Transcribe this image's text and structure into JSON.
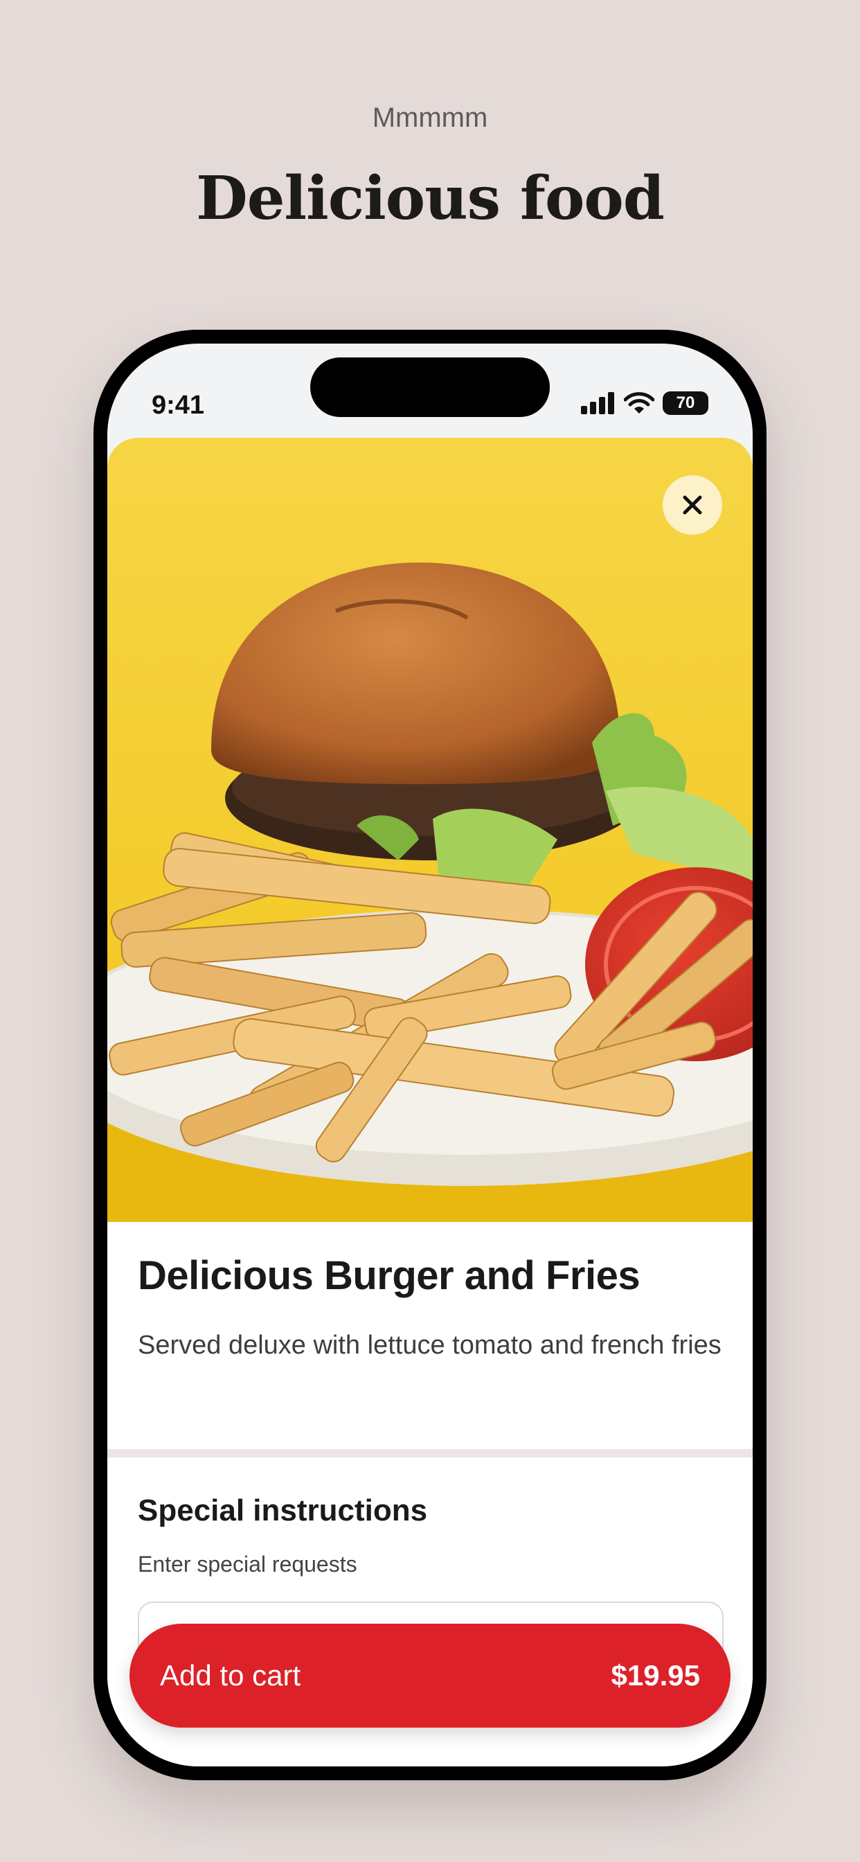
{
  "promo": {
    "eyebrow": "Mmmmm",
    "headline": "Delicious food"
  },
  "status_bar": {
    "time": "9:41",
    "battery": "70",
    "icons": [
      "signal-icon",
      "wifi-icon",
      "battery-icon"
    ]
  },
  "product": {
    "image_icon": "burger-fries-photo",
    "close_icon": "close-icon",
    "title": "Delicious Burger and Fries",
    "description": "Served deluxe with lettuce tomato and french fries"
  },
  "special_instructions": {
    "title": "Special instructions",
    "label": "Enter special requests",
    "value": ""
  },
  "cart": {
    "label": "Add to cart",
    "price": "$19.95",
    "color": "#dd2129"
  },
  "colors": {
    "background": "#e4dbd9",
    "hero_yellow": "#f7d440"
  }
}
